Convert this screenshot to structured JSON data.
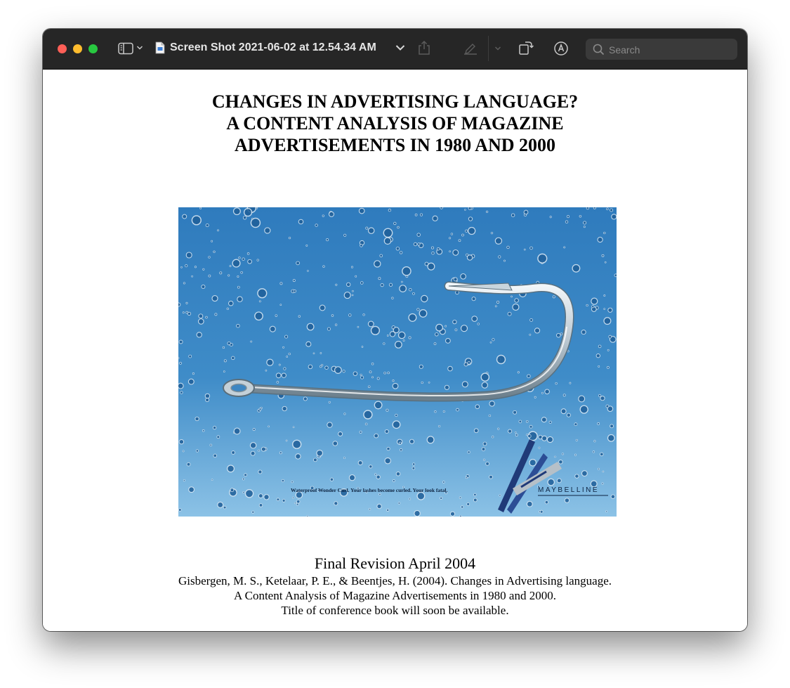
{
  "window": {
    "title": "Screen Shot 2021-06-02 at 12.54.34 AM",
    "search_placeholder": "Search",
    "icons": [
      "sidebar-icon",
      "chevron-down-icon",
      "document-icon",
      "share-icon",
      "markup-pen-icon",
      "rotate-icon",
      "annotate-icon",
      "search-icon"
    ]
  },
  "document": {
    "heading_lines": [
      "CHANGES IN ADVERTISING LANGUAGE?",
      "A CONTENT ANALYSIS OF MAGAZINE",
      "ADVERTISEMENTS IN 1980 AND 2000"
    ],
    "ad": {
      "tagline": "Waterproof Wonder Curl. Your lashes become curled. Your look fatal.",
      "brand": "MAYBELLINE"
    },
    "revision": "Final Revision April 2004",
    "citation_lines": [
      "Gisbergen, M. S., Ketelaar, P. E., & Beentjes, H. (2004). Changes in Advertising language.",
      "A Content Analysis of Magazine Advertisements in 1980 and 2000.",
      "Title of conference book will soon be available."
    ]
  },
  "colors": {
    "titlebar": "#262626",
    "close": "#fe5f57",
    "minimize": "#febc2e",
    "zoom": "#28c840",
    "ad_background": "#3d86c2"
  }
}
